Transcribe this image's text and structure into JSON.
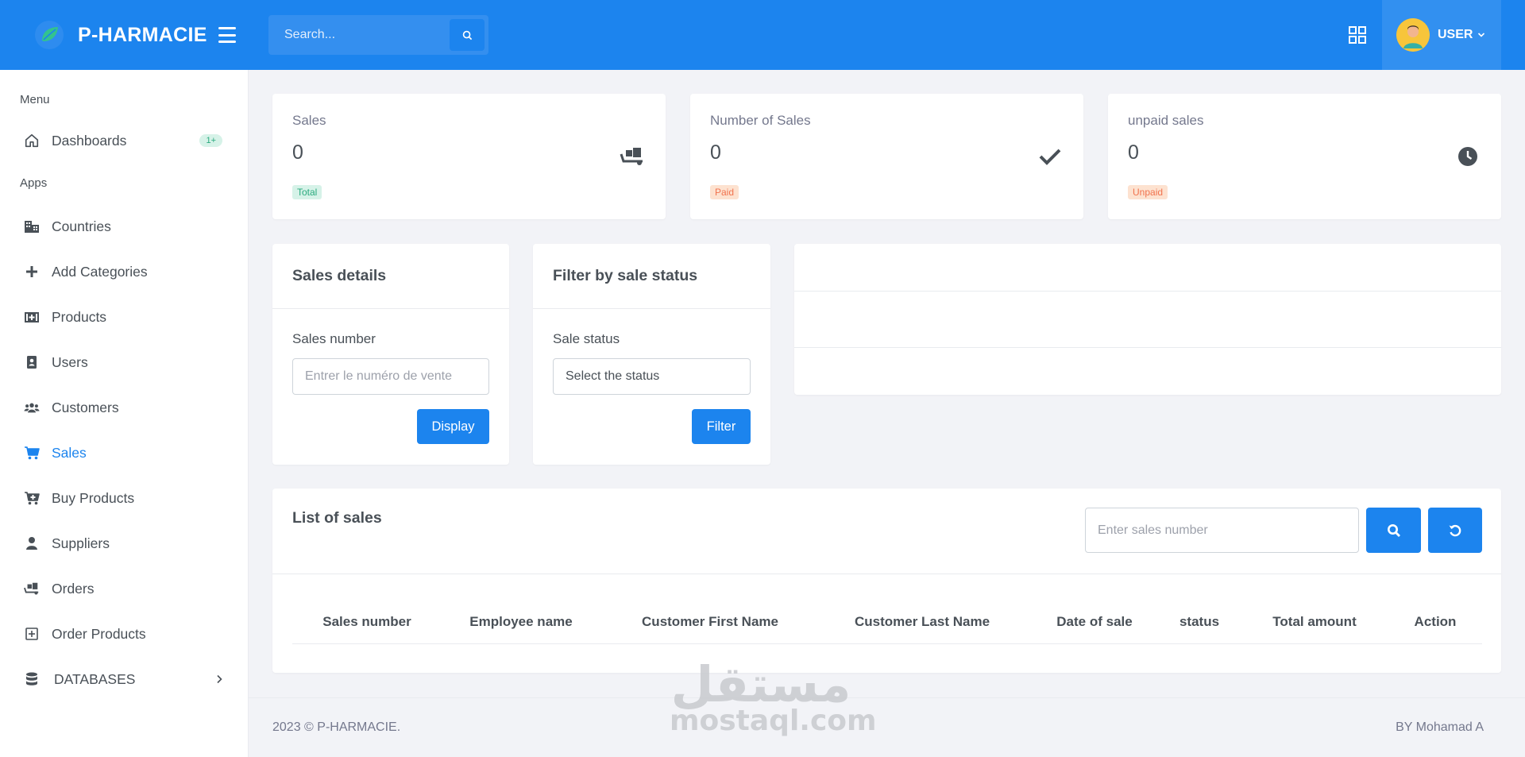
{
  "header": {
    "brand_name": "P-HARMACIE",
    "search_placeholder": "Search...",
    "user_name": "USER"
  },
  "sidebar": {
    "section_menu": "Menu",
    "section_apps": "Apps",
    "dashboards": {
      "label": "Dashboards",
      "badge": "1+"
    },
    "items": [
      {
        "label": "Countries",
        "icon": "building-icon"
      },
      {
        "label": "Add Categories",
        "icon": "plus-icon"
      },
      {
        "label": "Products",
        "icon": "medkit-icon"
      },
      {
        "label": "Users",
        "icon": "id-badge-icon"
      },
      {
        "label": "Customers",
        "icon": "users-icon"
      },
      {
        "label": "Sales",
        "icon": "cart-icon",
        "active": true
      },
      {
        "label": "Buy Products",
        "icon": "cart-plus-icon"
      },
      {
        "label": "Suppliers",
        "icon": "user-icon"
      },
      {
        "label": "Orders",
        "icon": "dolly-icon"
      },
      {
        "label": "Order Products",
        "icon": "plus-square-icon"
      }
    ],
    "databases": {
      "label": "DATABASES"
    }
  },
  "stats": [
    {
      "title": "Sales",
      "value": "0",
      "badge": "Total",
      "icon": "dolly-icon"
    },
    {
      "title": "Number of Sales",
      "value": "0",
      "badge": "Paid",
      "icon": "check-icon"
    },
    {
      "title": "unpaid sales",
      "value": "0",
      "badge": "Unpaid",
      "icon": "clock-icon"
    }
  ],
  "sales_details": {
    "title": "Sales details",
    "label": "Sales number",
    "placeholder": "Entrer le numéro de vente",
    "button": "Display"
  },
  "filter": {
    "title": "Filter by sale status",
    "label": "Sale status",
    "selected": "Select the status",
    "button": "Filter"
  },
  "list": {
    "title": "List of sales",
    "search_placeholder": "Enter sales number",
    "columns": [
      "Sales number",
      "Employee name",
      "Customer First Name",
      "Customer Last Name",
      "Date of sale",
      "status",
      "Total amount",
      "Action"
    ]
  },
  "footer": {
    "left": "2023 © P-HARMACIE.",
    "right": "BY Mohamad A"
  },
  "watermark": {
    "arabic": "مستقل",
    "latin": "mostaql.com"
  },
  "colors": {
    "primary": "#1c84ee",
    "success_soft": "#d6f2e8",
    "warning_soft": "#fde2d0"
  }
}
